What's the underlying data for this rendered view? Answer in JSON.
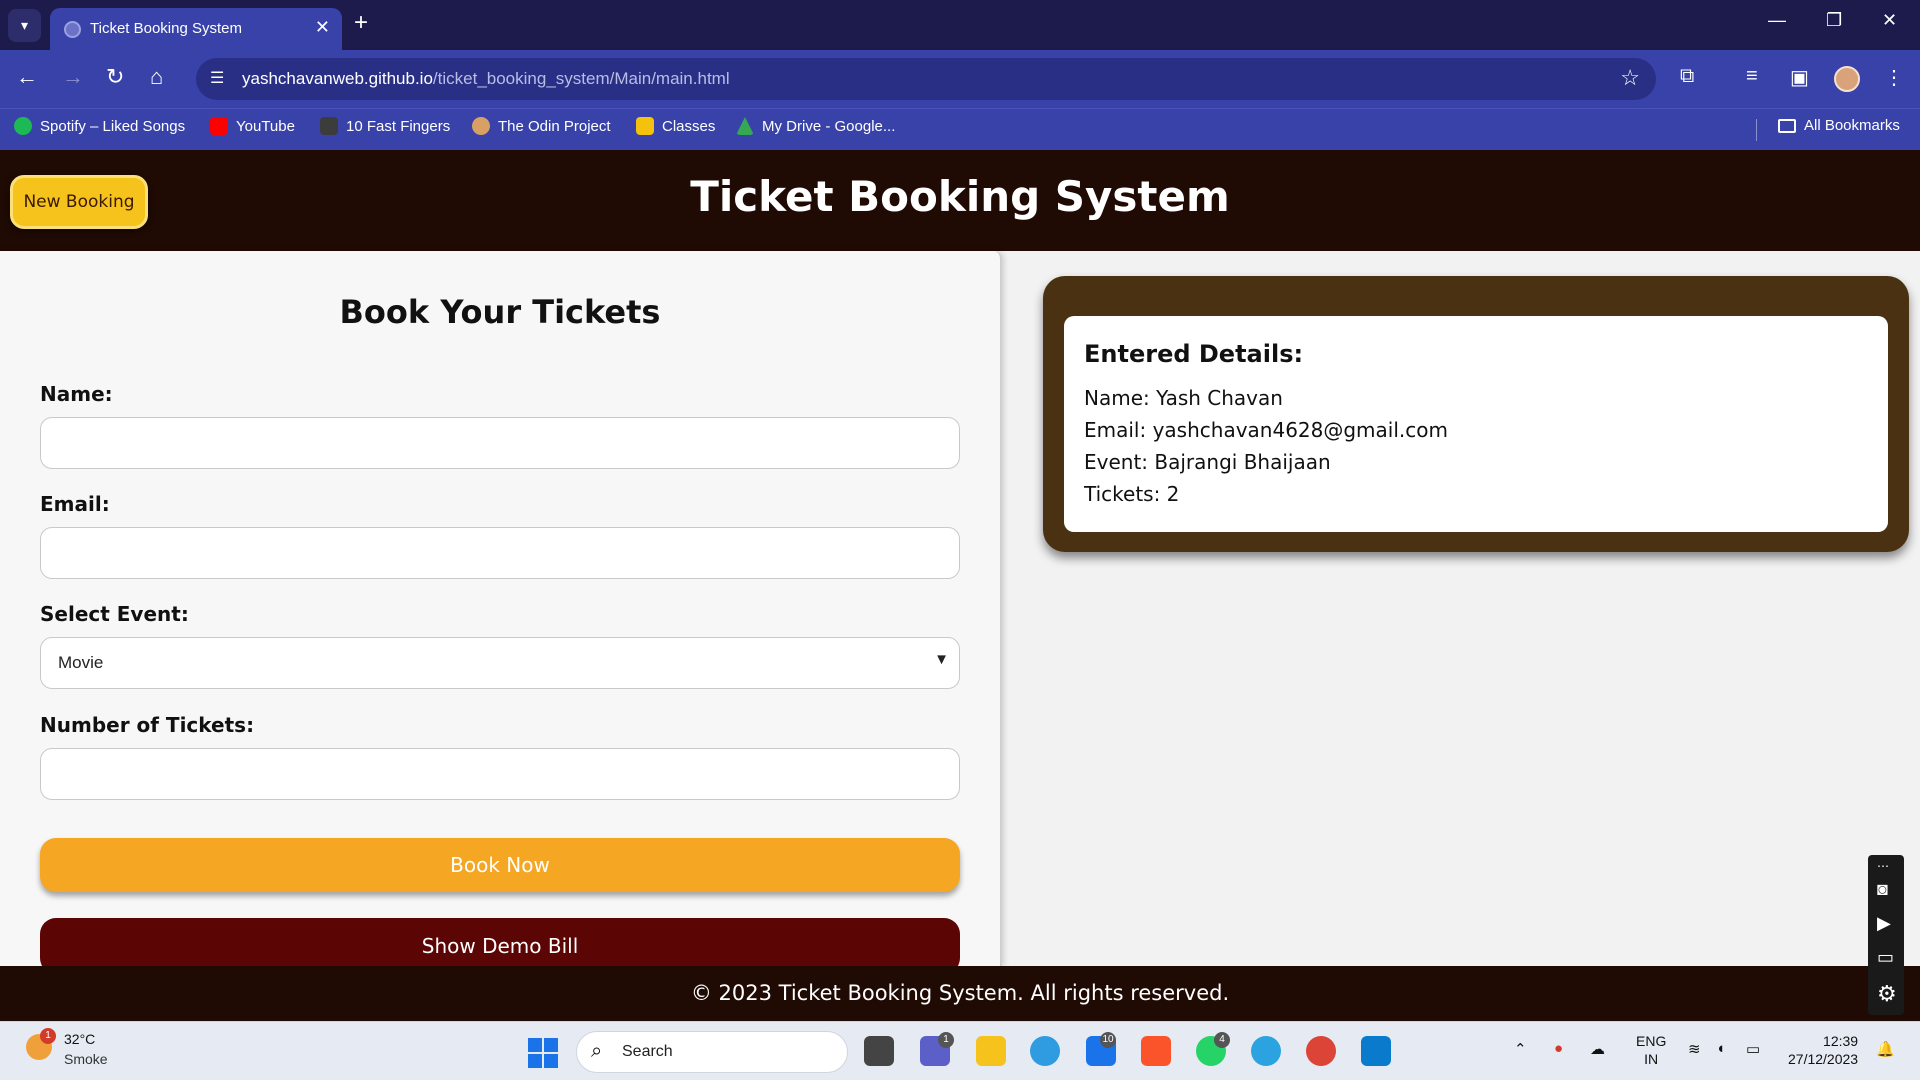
{
  "browser": {
    "tab_title": "Ticket Booking System",
    "url_domain": "yashchavanweb.github.io",
    "url_path": "/ticket_booking_system/Main/main.html",
    "bookmarks": [
      {
        "label": "Spotify – Liked Songs",
        "color": "#1db954"
      },
      {
        "label": "YouTube",
        "color": "#ff0000"
      },
      {
        "label": "10 Fast Fingers",
        "color": "#3c3c3c"
      },
      {
        "label": "The Odin Project",
        "color": "#d9a066"
      },
      {
        "label": "Classes",
        "color": "#f4c20d"
      },
      {
        "label": "My Drive - Google...",
        "color": "#34a853"
      }
    ],
    "all_bookmarks": "All Bookmarks"
  },
  "header": {
    "new_booking_label": "New Booking",
    "title": "Ticket Booking System"
  },
  "form": {
    "title": "Book Your Tickets",
    "name_label": "Name:",
    "name_value": "",
    "email_label": "Email:",
    "email_value": "",
    "event_label": "Select Event:",
    "event_value": "Movie",
    "tickets_label": "Number of Tickets:",
    "tickets_value": "",
    "book_now_label": "Book Now",
    "demo_bill_label": "Show Demo Bill"
  },
  "details": {
    "title": "Entered Details:",
    "name_line": "Name: Yash Chavan",
    "email_line": "Email: yashchavan4628@gmail.com",
    "event_line": "Event: Bajrangi Bhaijaan",
    "tickets_line": "Tickets: 2"
  },
  "footer": {
    "text": "© 2023 Ticket Booking System. All rights reserved."
  },
  "taskbar": {
    "weather_temp": "32°C",
    "weather_condition": "Smoke",
    "weather_badge": "1",
    "search_label": "Search",
    "teams_badge": "1",
    "mail_badge": "10",
    "whatsapp_badge": "4",
    "lang_line1": "ENG",
    "lang_line2": "IN",
    "time": "12:39",
    "date": "27/12/2023"
  },
  "colors": {
    "header_bg": "#200a04",
    "accent_yellow": "#f6c21c",
    "book_now": "#f5a623",
    "demo_bill": "#5c0505",
    "details_frame": "#4a3112",
    "browser_blue": "#3842a8"
  }
}
